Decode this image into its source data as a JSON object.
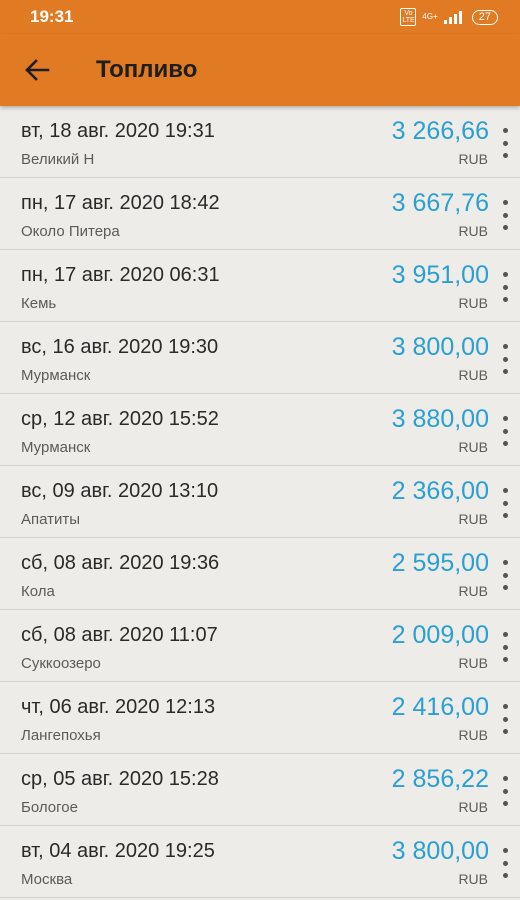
{
  "status_bar": {
    "time": "19:31",
    "volte_top": "Vo",
    "volte_bottom": "LTE",
    "network": "4G+",
    "battery": "27",
    "signal_icon": "signal-icon"
  },
  "app_bar": {
    "back_icon": "back-arrow-icon",
    "title": "Топливо",
    "background": "#e07b24"
  },
  "accent_color": "#2a9fd2",
  "entries": [
    {
      "date": "вт, 18 авг. 2020 19:31",
      "place": "Великий Н",
      "amount": "3 266,66",
      "currency": "RUB"
    },
    {
      "date": "пн, 17 авг. 2020 18:42",
      "place": "Около Питера",
      "amount": "3 667,76",
      "currency": "RUB"
    },
    {
      "date": "пн, 17 авг. 2020 06:31",
      "place": "Кемь",
      "amount": "3 951,00",
      "currency": "RUB"
    },
    {
      "date": "вс, 16 авг. 2020 19:30",
      "place": "Мурманск",
      "amount": "3 800,00",
      "currency": "RUB"
    },
    {
      "date": "ср, 12 авг. 2020 15:52",
      "place": "Мурманск",
      "amount": "3 880,00",
      "currency": "RUB"
    },
    {
      "date": "вс, 09 авг. 2020 13:10",
      "place": "Апатиты",
      "amount": "2 366,00",
      "currency": "RUB"
    },
    {
      "date": "сб, 08 авг. 2020 19:36",
      "place": "Кола",
      "amount": "2 595,00",
      "currency": "RUB"
    },
    {
      "date": "сб, 08 авг. 2020 11:07",
      "place": "Суккоозеро",
      "amount": "2 009,00",
      "currency": "RUB"
    },
    {
      "date": "чт, 06 авг. 2020 12:13",
      "place": "Лангепохья",
      "amount": "2 416,00",
      "currency": "RUB"
    },
    {
      "date": "ср, 05 авг. 2020 15:28",
      "place": "Бологое",
      "amount": "2 856,22",
      "currency": "RUB"
    },
    {
      "date": "вт, 04 авг. 2020 19:25",
      "place": "Москва",
      "amount": "3 800,00",
      "currency": "RUB"
    }
  ]
}
